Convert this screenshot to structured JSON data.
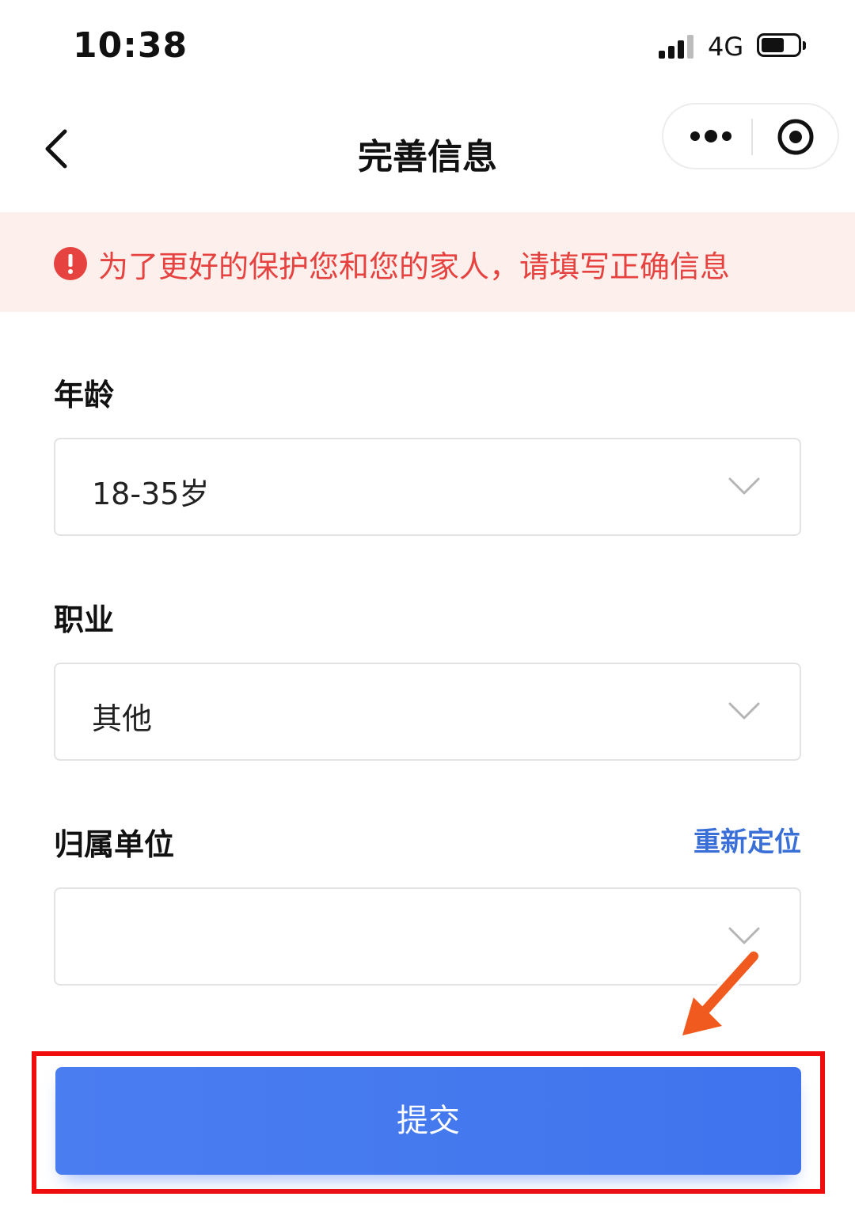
{
  "status_bar": {
    "time": "10:38",
    "network": "4G",
    "signal_icon": "signal-bars-icon",
    "battery_icon": "battery-icon"
  },
  "nav": {
    "title": "完善信息",
    "back_icon": "chevron-left-icon",
    "more_icon": "more-dots-icon",
    "close_icon": "target-close-icon"
  },
  "notice": {
    "icon": "exclamation-circle-icon",
    "text": "为了更好的保护您和您的家人，请填写正确信息",
    "color": "#e64340",
    "background": "#fcefec"
  },
  "form": {
    "age": {
      "label": "年龄",
      "value": "18-35岁"
    },
    "occupation": {
      "label": "职业",
      "value": "其他"
    },
    "unit": {
      "label": "归属单位",
      "relocate_label": "重新定位",
      "value": ""
    }
  },
  "submit": {
    "label": "提交",
    "color": "#4a7df0"
  },
  "annotation": {
    "arrow_color": "#f05a1e",
    "highlight_color": "#f00d0d"
  }
}
